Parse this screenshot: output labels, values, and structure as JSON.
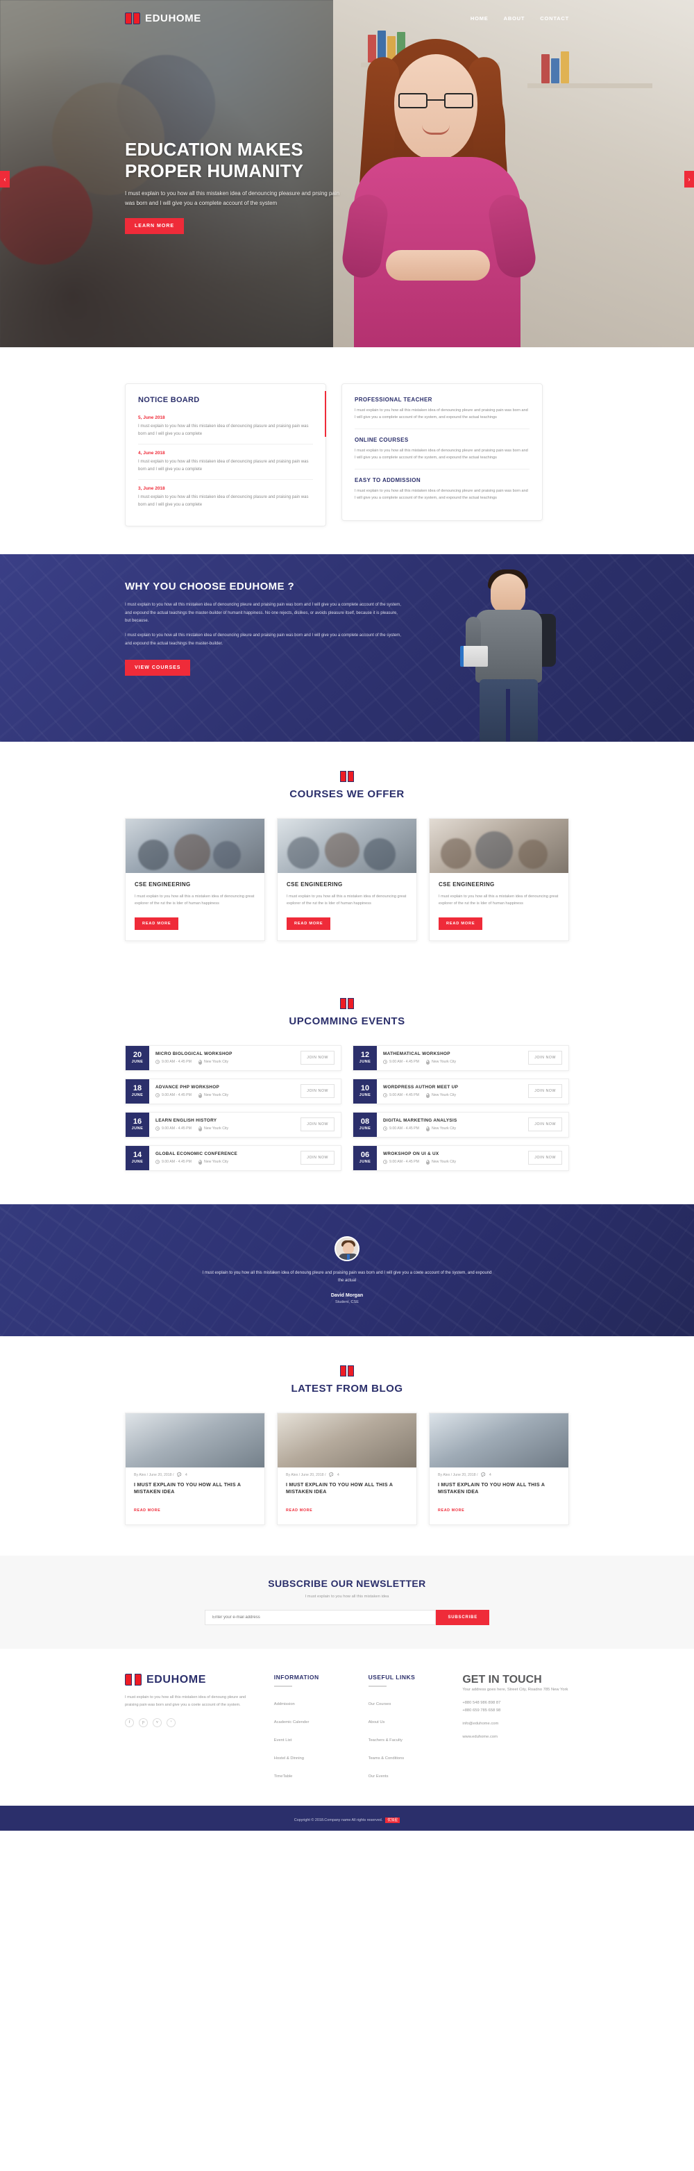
{
  "brand": {
    "name": "EDUHOME",
    "icon": "book-icon"
  },
  "nav": {
    "items": [
      {
        "label": "HOME"
      },
      {
        "label": "ABOUT"
      },
      {
        "label": "CONTACT"
      }
    ]
  },
  "hero": {
    "title_line1": "EDUCATION MAKES",
    "title_line2": "PROPER HUMANITY",
    "paragraph": "I must explain to you how all this mistaken idea of denouncing pleasure and prsing pain was born and I will give you a complete account of the system",
    "cta": "LEARN MORE",
    "prev_arrow": "‹",
    "next_arrow": "›"
  },
  "notice": {
    "title": "NOTICE BOARD",
    "items": [
      {
        "date": "5, June 2018",
        "text": "I must explain to you how all this mistaken idea of denouncing plasure and praising pain was born and I will give you a complete"
      },
      {
        "date": "4, June 2018",
        "text": "I must explain to you how all this mistaken idea of denouncing plasure and praising pain was born and I will give you a complete"
      },
      {
        "date": "3, June 2018",
        "text": "I must explain to you how all this mistaken idea of denouncing plasure and praising pain was born and I will give you a complete"
      }
    ]
  },
  "features": {
    "items": [
      {
        "title": "PROFESSIONAL TEACHER",
        "text": "I must explain to you how all this mistaken idea of denouncing pleure and praising pain was born and I will give you a complete account of the system, and expound the actual teachings"
      },
      {
        "title": "ONLINE COURSES",
        "text": "I must explain to you how all this mistaken idea of denouncing pleure and praising pain was born and I will give you a complete account of the system, and expound the actual teachings"
      },
      {
        "title": "EASY TO ADDMISSION",
        "text": "I must explain to you how all this mistaken idea of denouncing pleure and praising pain was born and I will give you a complete account of the system, and expound the actual teachings"
      }
    ]
  },
  "why": {
    "title": "WHY YOU CHOOSE EDUHOME ?",
    "paragraph1": "I must explain to you how all this mistaken idea of denouncing pleure and praising pain was born and I will give you a complete account of the system, and expound the actual teachings the master-builder of humanit happiness. No one rejects, dislikes, or avoids pleasure itself, because it is pleasure, but because.",
    "paragraph2": "I must explain to you how all this mistaken idea of denouncing pleure and praising pain was born and I will give you a complete account of the system, and expound the actual teachings the master-builder.",
    "cta": "VIEW COURSES"
  },
  "courses": {
    "heading": "COURSES WE OFFER",
    "items": [
      {
        "title": "CSE ENGINEERING",
        "text": "I must explain to you how all this a mistaken idea of denouncing great explorer of the rut the is Ider of human happiness",
        "cta": "READ MORE"
      },
      {
        "title": "CSE ENGINEERING",
        "text": "I must explain to you how all this a mistaken idea of denouncing great explorer of the rut the is Ider of human happiness",
        "cta": "READ MORE"
      },
      {
        "title": "CSE ENGINEERING",
        "text": "I must explain to you how all this a mistaken idea of denouncing great explorer of the rut the is Ider of human happiness",
        "cta": "READ MORE"
      }
    ]
  },
  "events": {
    "heading": "UPCOMMING EVENTS",
    "join_label": "JOIN NOW",
    "left": [
      {
        "day": "20",
        "month": "JUNE",
        "title": "MICRO BIOLOGICAL WORKSHOP",
        "time": "9.00 AM - 4.45 PM",
        "place": "New Yourk City"
      },
      {
        "day": "18",
        "month": "JUNE",
        "title": "ADVANCE PHP WORKSHOP",
        "time": "9.00 AM - 4.45 PM",
        "place": "New Yourk City"
      },
      {
        "day": "16",
        "month": "JUNE",
        "title": "LEARN ENGLISH HISTORY",
        "time": "9.00 AM - 4.45 PM",
        "place": "New Yourk City"
      },
      {
        "day": "14",
        "month": "JUNE",
        "title": "GLOBAL ECONOMIC CONFERENCE",
        "time": "9.00 AM - 4.45 PM",
        "place": "New Yourk City"
      }
    ],
    "right": [
      {
        "day": "12",
        "month": "JUNE",
        "title": "MATHEMATICAL WORKSHOP",
        "time": "9.00 AM - 4.45 PM",
        "place": "New Yourk City"
      },
      {
        "day": "10",
        "month": "JUNE",
        "title": "WORDPRESS AUTHOR MEET UP",
        "time": "9.00 AM - 4.45 PM",
        "place": "New Yourk City"
      },
      {
        "day": "08",
        "month": "JUNE",
        "title": "DIGITAL MARKETING ANALYSIS",
        "time": "9.00 AM - 4.45 PM",
        "place": "New Yourk City"
      },
      {
        "day": "06",
        "month": "JUNE",
        "title": "WROKSHOP ON UI & UX",
        "time": "9.00 AM - 4.45 PM",
        "place": "New Yourk City"
      }
    ]
  },
  "testimonial": {
    "quote": "I must explain to you how all this mistaken idea of denoung pleure and praising pain was born and I will give you a coete account of the system, and expound the actual",
    "name": "David Morgan",
    "role": "Student, CSE"
  },
  "blog": {
    "heading": "LATEST FROM BLOG",
    "items": [
      {
        "meta": "By Alex / June 20, 2018 /",
        "comments": "4",
        "title": "I MUST EXPLAIN TO YOU HOW ALL THIS A MISTAKEN IDEA",
        "cta": "READ MORE"
      },
      {
        "meta": "By Alex / June 20, 2018 /",
        "comments": "4",
        "title": "I MUST EXPLAIN TO YOU HOW ALL THIS A MISTAKEN IDEA",
        "cta": "READ MORE"
      },
      {
        "meta": "By Alex / June 20, 2018 /",
        "comments": "4",
        "title": "I MUST EXPLAIN TO YOU HOW ALL THIS A MISTAKEN IDEA",
        "cta": "READ MORE"
      }
    ]
  },
  "newsletter": {
    "title": "SUBSCRIBE OUR NEWSLETTER",
    "subtitle": "I must explain to you how all this mistaken idea",
    "placeholder": "Enter your e-mail address",
    "button": "SUBSCRIBE"
  },
  "footer": {
    "about": "I must explain to you how all this mistaken idea of denoung pleure and praising pain was born and give you a coete account of the system.",
    "socials": [
      {
        "name": "facebook-icon",
        "glyph": "f"
      },
      {
        "name": "pinterest-icon",
        "glyph": "р"
      },
      {
        "name": "vimeo-icon",
        "glyph": "v"
      },
      {
        "name": "twitter-icon",
        "glyph": "ᵛ"
      }
    ],
    "information": {
      "title": "INFORMATION",
      "links": [
        "Addmission",
        "Academic Calender",
        "Event List",
        "Hostel & Dinning",
        "TimeTable"
      ]
    },
    "useful": {
      "title": "USEFUL LINKS",
      "links": [
        "Our Courses",
        "About Us",
        "Teachers & Faculty",
        "Teams & Conditions",
        "Our Events"
      ]
    },
    "touch": {
      "title": "GET IN TOUCH",
      "address": "Your address goes here, Street City, Roadno 785 New York",
      "phones": "+880 548 986 898 87\n+880 659 785 658 98",
      "email": "info@eduhome.com",
      "website": "www.eduhome.com"
    }
  },
  "copyright": {
    "text": "Copyright © 2018.Company name All rights reserved.",
    "badge": "优加星"
  },
  "colors": {
    "accent_red": "#ef2b39",
    "navy": "#2b2f6b",
    "muted": "#949494"
  }
}
